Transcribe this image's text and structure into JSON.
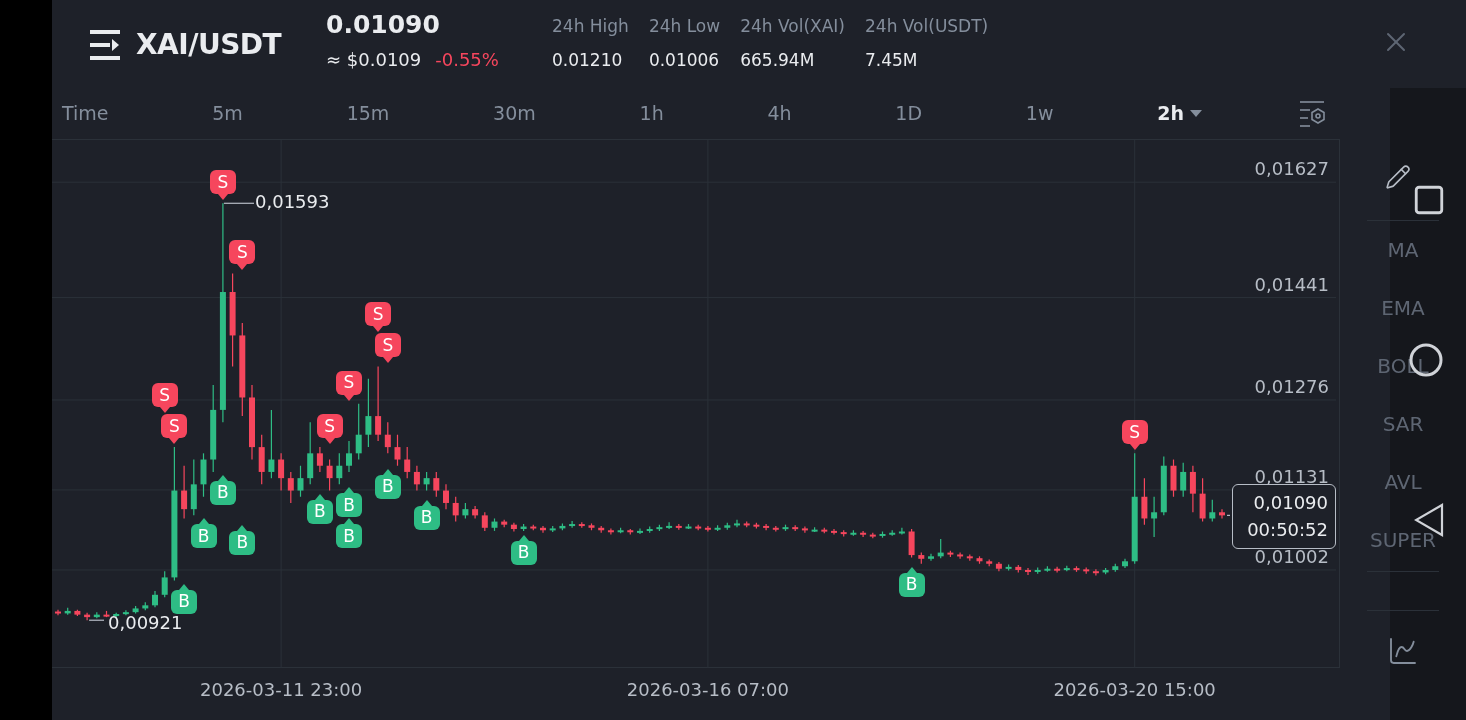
{
  "header": {
    "pair": "XAI/USDT",
    "price": "0.01090",
    "usd_price": "≈ $0.0109",
    "change": "-0.55%",
    "stats": [
      {
        "label": "24h High",
        "value": "0.01210"
      },
      {
        "label": "24h Low",
        "value": "0.01006"
      },
      {
        "label": "24h Vol(XAI)",
        "value": "665.94M"
      },
      {
        "label": "24h Vol(USDT)",
        "value": "7.45M"
      }
    ]
  },
  "intervals": [
    {
      "label": "Time",
      "selected": false
    },
    {
      "label": "5m",
      "selected": false
    },
    {
      "label": "15m",
      "selected": false
    },
    {
      "label": "30m",
      "selected": false
    },
    {
      "label": "1h",
      "selected": false
    },
    {
      "label": "4h",
      "selected": false
    },
    {
      "label": "1D",
      "selected": false
    },
    {
      "label": "1w",
      "selected": false
    },
    {
      "label": "2h",
      "selected": true
    }
  ],
  "chart": {
    "chart_data": {
      "type": "candlestick",
      "categories": [
        null,
        null,
        null,
        null,
        null,
        null,
        null,
        null,
        null,
        null,
        null,
        null,
        null,
        null,
        null,
        null,
        null,
        null,
        null,
        null,
        null,
        null,
        null,
        "2026-03-11 23:00",
        null,
        null,
        null,
        null,
        null,
        null,
        null,
        null,
        null,
        null,
        null,
        null,
        null,
        null,
        null,
        null,
        null,
        null,
        null,
        null,
        null,
        null,
        null,
        null,
        null,
        null,
        null,
        null,
        null,
        null,
        null,
        null,
        null,
        null,
        null,
        null,
        null,
        null,
        null,
        null,
        null,
        null,
        null,
        "2026-03-16 07:00",
        null,
        null,
        null,
        null,
        null,
        null,
        null,
        null,
        null,
        null,
        null,
        null,
        null,
        null,
        null,
        null,
        null,
        null,
        null,
        null,
        null,
        null,
        null,
        null,
        null,
        null,
        null,
        null,
        null,
        null,
        null,
        null,
        null,
        null,
        null,
        null,
        null,
        null,
        null,
        null,
        null,
        null,
        null,
        "2026-03-20 15:00",
        null,
        null,
        null,
        null,
        null,
        null,
        null,
        null,
        null
      ],
      "ylim": [
        0.00844,
        0.01695
      ],
      "grid": true,
      "yticks": [
        {
          "value": 0.01627,
          "label": "0,01627"
        },
        {
          "value": 0.01441,
          "label": "0,01441"
        },
        {
          "value": 0.01276,
          "label": "0,01276"
        },
        {
          "value": 0.01131,
          "label": "0,01131"
        },
        {
          "value": 0.01002,
          "label": "0,01002"
        }
      ],
      "ohlc": [
        [
          0.00935,
          0.00938,
          0.00929,
          0.00932
        ],
        [
          0.00932,
          0.00941,
          0.0093,
          0.00936
        ],
        [
          0.00936,
          0.00938,
          0.00928,
          0.0093
        ],
        [
          0.0093,
          0.00933,
          0.00921,
          0.00926
        ],
        [
          0.00926,
          0.00934,
          0.00924,
          0.0093
        ],
        [
          0.0093,
          0.00936,
          0.00926,
          0.00928
        ],
        [
          0.00928,
          0.00933,
          0.00925,
          0.00931
        ],
        [
          0.00931,
          0.00937,
          0.00929,
          0.00934
        ],
        [
          0.00934,
          0.00944,
          0.00932,
          0.0094
        ],
        [
          0.0094,
          0.0095,
          0.00937,
          0.00945
        ],
        [
          0.00945,
          0.00968,
          0.00942,
          0.00962
        ],
        [
          0.00962,
          0.01,
          0.00958,
          0.0099
        ],
        [
          0.0099,
          0.012,
          0.00985,
          0.0113
        ],
        [
          0.0113,
          0.0117,
          0.01085,
          0.011
        ],
        [
          0.011,
          0.0118,
          0.0109,
          0.0114
        ],
        [
          0.0114,
          0.0119,
          0.0112,
          0.0118
        ],
        [
          0.0118,
          0.013,
          0.0116,
          0.0126
        ],
        [
          0.0126,
          0.01593,
          0.0124,
          0.0145
        ],
        [
          0.0145,
          0.0148,
          0.0133,
          0.0138
        ],
        [
          0.0138,
          0.014,
          0.0125,
          0.0128
        ],
        [
          0.0128,
          0.013,
          0.0118,
          0.012
        ],
        [
          0.012,
          0.0122,
          0.0114,
          0.0116
        ],
        [
          0.0116,
          0.0126,
          0.0115,
          0.0118
        ],
        [
          0.0118,
          0.0119,
          0.0113,
          0.0115
        ],
        [
          0.0115,
          0.0116,
          0.0111,
          0.0113
        ],
        [
          0.0113,
          0.0117,
          0.0112,
          0.0115
        ],
        [
          0.0115,
          0.0124,
          0.0114,
          0.0119
        ],
        [
          0.0119,
          0.012,
          0.0116,
          0.0117
        ],
        [
          0.0117,
          0.0118,
          0.0113,
          0.0115
        ],
        [
          0.0115,
          0.0119,
          0.0114,
          0.0117
        ],
        [
          0.0117,
          0.0121,
          0.0116,
          0.0119
        ],
        [
          0.0119,
          0.0127,
          0.0118,
          0.0122
        ],
        [
          0.0122,
          0.0131,
          0.012,
          0.0125
        ],
        [
          0.0125,
          0.0133,
          0.0121,
          0.0122
        ],
        [
          0.0122,
          0.0124,
          0.0119,
          0.012
        ],
        [
          0.012,
          0.0122,
          0.0117,
          0.0118
        ],
        [
          0.0118,
          0.012,
          0.0115,
          0.0116
        ],
        [
          0.0116,
          0.0117,
          0.0113,
          0.0114
        ],
        [
          0.0114,
          0.0116,
          0.0113,
          0.0115
        ],
        [
          0.0115,
          0.0116,
          0.0112,
          0.0113
        ],
        [
          0.0113,
          0.0114,
          0.011,
          0.0111
        ],
        [
          0.0111,
          0.0112,
          0.0108,
          0.0109
        ],
        [
          0.0109,
          0.0111,
          0.01085,
          0.011
        ],
        [
          0.011,
          0.01105,
          0.01085,
          0.0109
        ],
        [
          0.0109,
          0.01095,
          0.01065,
          0.0107
        ],
        [
          0.0107,
          0.01085,
          0.01065,
          0.0108
        ],
        [
          0.0108,
          0.01083,
          0.01071,
          0.01075
        ],
        [
          0.01075,
          0.01078,
          0.01064,
          0.01068
        ],
        [
          0.01068,
          0.01076,
          0.01065,
          0.01072
        ],
        [
          0.01072,
          0.01075,
          0.01066,
          0.0107
        ],
        [
          0.0107,
          0.01073,
          0.01062,
          0.01066
        ],
        [
          0.01066,
          0.01073,
          0.01063,
          0.01069
        ],
        [
          0.01069,
          0.01077,
          0.01066,
          0.01073
        ],
        [
          0.01073,
          0.01081,
          0.0107,
          0.01076
        ],
        [
          0.01076,
          0.01079,
          0.0107,
          0.01074
        ],
        [
          0.01074,
          0.01077,
          0.01066,
          0.0107
        ],
        [
          0.0107,
          0.01073,
          0.01062,
          0.01066
        ],
        [
          0.01066,
          0.01069,
          0.01059,
          0.01064
        ],
        [
          0.01064,
          0.0107,
          0.01061,
          0.01066
        ],
        [
          0.01066,
          0.01068,
          0.01059,
          0.01063
        ],
        [
          0.01063,
          0.01069,
          0.0106,
          0.01065
        ],
        [
          0.01065,
          0.01072,
          0.01062,
          0.01068
        ],
        [
          0.01068,
          0.01075,
          0.01065,
          0.01071
        ],
        [
          0.01071,
          0.01079,
          0.01068,
          0.01073
        ],
        [
          0.01073,
          0.01076,
          0.01067,
          0.01071
        ],
        [
          0.01071,
          0.01076,
          0.01068,
          0.01072
        ],
        [
          0.01072,
          0.01075,
          0.01066,
          0.0107
        ],
        [
          0.0107,
          0.01073,
          0.01064,
          0.01068
        ],
        [
          0.01068,
          0.01074,
          0.01065,
          0.0107
        ],
        [
          0.0107,
          0.01078,
          0.01067,
          0.01074
        ],
        [
          0.01074,
          0.01083,
          0.01071,
          0.01077
        ],
        [
          0.01077,
          0.0108,
          0.01071,
          0.01075
        ],
        [
          0.01075,
          0.01078,
          0.01069,
          0.01073
        ],
        [
          0.01073,
          0.01076,
          0.01066,
          0.0107
        ],
        [
          0.0107,
          0.01073,
          0.01064,
          0.01068
        ],
        [
          0.01068,
          0.01075,
          0.01065,
          0.01071
        ],
        [
          0.01071,
          0.01074,
          0.01065,
          0.01069
        ],
        [
          0.01069,
          0.01072,
          0.01062,
          0.01066
        ],
        [
          0.01066,
          0.01071,
          0.01063,
          0.01067
        ],
        [
          0.01067,
          0.0107,
          0.01061,
          0.01065
        ],
        [
          0.01065,
          0.01068,
          0.01059,
          0.01063
        ],
        [
          0.01063,
          0.01066,
          0.01056,
          0.0106
        ],
        [
          0.0106,
          0.01066,
          0.01057,
          0.01062
        ],
        [
          0.01062,
          0.01065,
          0.01055,
          0.01059
        ],
        [
          0.01059,
          0.01062,
          0.01053,
          0.01057
        ],
        [
          0.01057,
          0.01064,
          0.01054,
          0.0106
        ],
        [
          0.0106,
          0.01066,
          0.01057,
          0.01062
        ],
        [
          0.01062,
          0.0107,
          0.01059,
          0.01064
        ],
        [
          0.01064,
          0.01068,
          0.01022,
          0.01026
        ],
        [
          0.01026,
          0.0103,
          0.01012,
          0.0102
        ],
        [
          0.0102,
          0.01028,
          0.01017,
          0.01024
        ],
        [
          0.01024,
          0.01052,
          0.01021,
          0.0103
        ],
        [
          0.0103,
          0.01033,
          0.01023,
          0.01027
        ],
        [
          0.01027,
          0.0103,
          0.0102,
          0.01024
        ],
        [
          0.01024,
          0.01027,
          0.01017,
          0.01021
        ],
        [
          0.01021,
          0.01024,
          0.01012,
          0.01016
        ],
        [
          0.01016,
          0.01019,
          0.01008,
          0.01012
        ],
        [
          0.01012,
          0.01015,
          0.01,
          0.01004
        ],
        [
          0.01004,
          0.01011,
          0.01001,
          0.01007
        ],
        [
          0.01007,
          0.0101,
          0.00998,
          0.01002
        ],
        [
          0.01002,
          0.01005,
          0.00994,
          0.00999
        ],
        [
          0.00999,
          0.01006,
          0.00996,
          0.01002
        ],
        [
          0.01002,
          0.01008,
          0.00999,
          0.01004
        ],
        [
          0.01004,
          0.01007,
          0.00998,
          0.01003
        ],
        [
          0.01003,
          0.01009,
          0.01,
          0.01005
        ],
        [
          0.01005,
          0.01008,
          0.00999,
          0.01003
        ],
        [
          0.01003,
          0.01006,
          0.00996,
          0.01
        ],
        [
          0.01,
          0.01003,
          0.00993,
          0.00998
        ],
        [
          0.00998,
          0.01005,
          0.00995,
          0.01002
        ],
        [
          0.01002,
          0.01012,
          0.00999,
          0.01008
        ],
        [
          0.01008,
          0.0102,
          0.01005,
          0.01016
        ],
        [
          0.01016,
          0.0119,
          0.01012,
          0.0112
        ],
        [
          0.0112,
          0.0115,
          0.01075,
          0.01085
        ],
        [
          0.01085,
          0.0112,
          0.01055,
          0.01095
        ],
        [
          0.01095,
          0.01185,
          0.0109,
          0.0117
        ],
        [
          0.0117,
          0.0118,
          0.0112,
          0.0113
        ],
        [
          0.0113,
          0.01175,
          0.0112,
          0.0116
        ],
        [
          0.0116,
          0.0117,
          0.01095,
          0.01125
        ],
        [
          0.01125,
          0.0115,
          0.0108,
          0.01085
        ],
        [
          0.01085,
          0.01115,
          0.0108,
          0.01095
        ],
        [
          0.01095,
          0.011,
          0.01085,
          0.0109
        ]
      ]
    },
    "high_label": "0,01593",
    "low_label": "0,00921",
    "last_price": "0,01090",
    "countdown": "00:50:52",
    "markers": [
      {
        "kind": "sell",
        "label": "S"
      },
      {
        "kind": "sell",
        "label": "S"
      },
      {
        "kind": "sell",
        "label": "S"
      },
      {
        "kind": "sell",
        "label": "S"
      },
      {
        "kind": "sell",
        "label": "S"
      },
      {
        "kind": "sell",
        "label": "S"
      },
      {
        "kind": "sell",
        "label": "S"
      },
      {
        "kind": "sell",
        "label": "S"
      },
      {
        "kind": "sell",
        "label": "S"
      },
      {
        "kind": "buy",
        "label": "B"
      },
      {
        "kind": "buy",
        "label": "B"
      },
      {
        "kind": "buy",
        "label": "B"
      },
      {
        "kind": "buy",
        "label": "B"
      },
      {
        "kind": "buy",
        "label": "B"
      },
      {
        "kind": "buy",
        "label": "B"
      },
      {
        "kind": "buy",
        "label": "B"
      },
      {
        "kind": "buy",
        "label": "B"
      },
      {
        "kind": "buy",
        "label": "B"
      },
      {
        "kind": "buy",
        "label": "B"
      },
      {
        "kind": "buy",
        "label": "B"
      }
    ]
  },
  "indicators": [
    "MA",
    "EMA",
    "BOLL",
    "SAR",
    "AVL",
    "SUPER"
  ]
}
